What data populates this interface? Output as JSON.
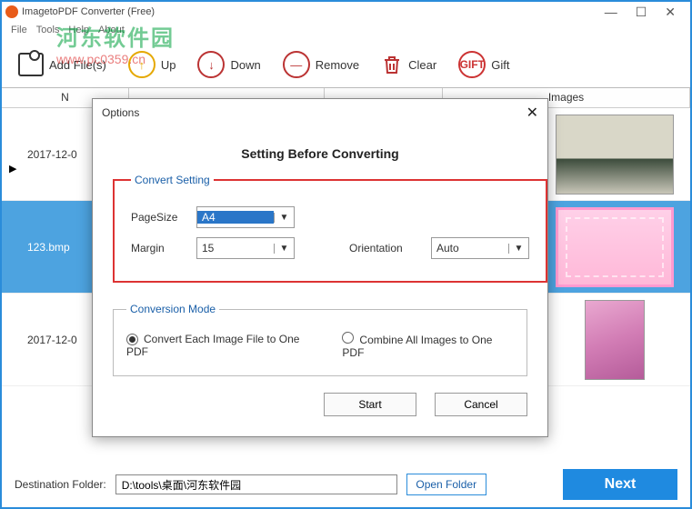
{
  "titlebar": {
    "title": "ImagetoPDF Converter (Free)"
  },
  "menu": {
    "file": "File",
    "tools": "Tools",
    "help": "Help",
    "about": "About"
  },
  "watermark": {
    "line1": "河东软件园",
    "line2": "www.pc0359.cn"
  },
  "toolbar": {
    "add": "Add File(s)",
    "up": "Up",
    "down": "Down",
    "remove": "Remove",
    "clear": "Clear",
    "gift": "Gift",
    "gift_badge": "GIFT"
  },
  "table": {
    "headers": {
      "name": "N",
      "path": "",
      "size": "",
      "images": "Images"
    },
    "rows": [
      {
        "name": "2017-12-0"
      },
      {
        "name": "123.bmp"
      },
      {
        "name": "2017-12-0"
      }
    ]
  },
  "dialog": {
    "title": "Options",
    "heading": "Setting Before Converting",
    "convert_legend": "Convert Setting",
    "pagesize_label": "PageSize",
    "pagesize_value": "A4",
    "margin_label": "Margin",
    "margin_value": "15",
    "orientation_label": "Orientation",
    "orientation_value": "Auto",
    "mode_legend": "Conversion Mode",
    "mode_each": "Convert Each Image File to One PDF",
    "mode_combine": "Combine All Images to One PDF",
    "start": "Start",
    "cancel": "Cancel"
  },
  "footer": {
    "label": "Destination Folder:",
    "path": "D:\\tools\\桌面\\河东软件园",
    "open": "Open Folder",
    "next": "Next"
  }
}
